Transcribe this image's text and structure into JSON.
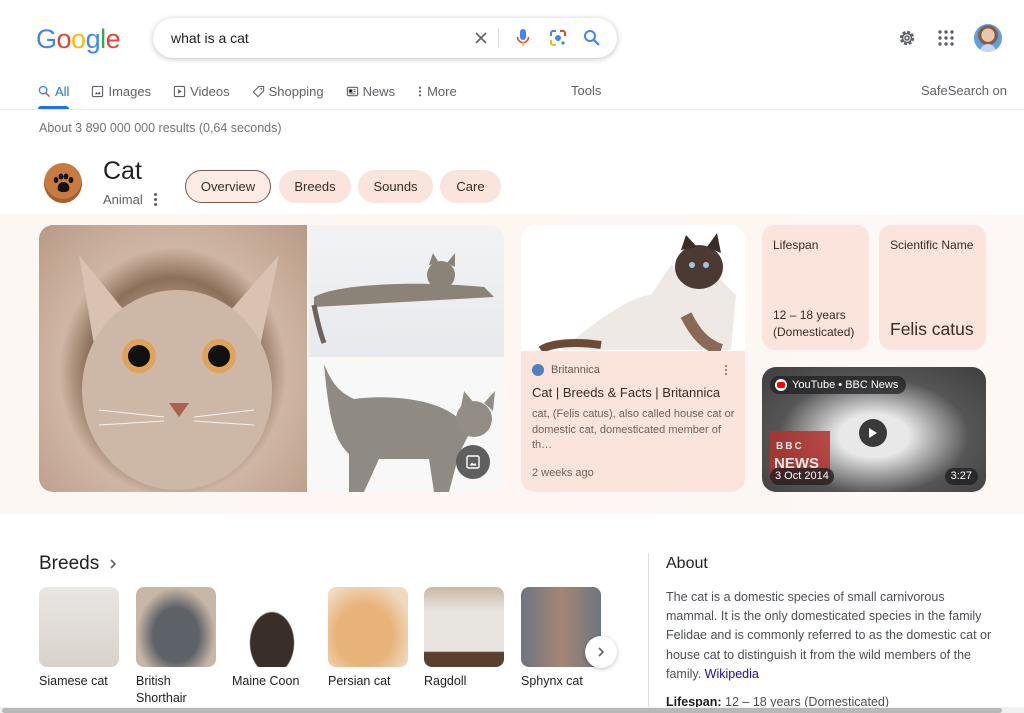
{
  "header": {
    "logo_letters": [
      {
        "ch": "G",
        "color": "#4285f4"
      },
      {
        "ch": "o",
        "color": "#ea4335"
      },
      {
        "ch": "o",
        "color": "#fbbc05"
      },
      {
        "ch": "g",
        "color": "#4285f4"
      },
      {
        "ch": "l",
        "color": "#34a853"
      },
      {
        "ch": "e",
        "color": "#ea4335"
      }
    ],
    "search_query": "what is a cat",
    "icons": [
      "clear-icon",
      "microphone-icon",
      "lens-icon",
      "search-icon",
      "gear-icon",
      "apps-grid-icon",
      "avatar"
    ]
  },
  "tabs": [
    {
      "label": "All",
      "icon": "search-icon",
      "active": true
    },
    {
      "label": "Images",
      "icon": "image-icon"
    },
    {
      "label": "Videos",
      "icon": "play-icon"
    },
    {
      "label": "Shopping",
      "icon": "tag-icon"
    },
    {
      "label": "News",
      "icon": "news-icon"
    },
    {
      "label": "More",
      "icon": "more-vertical-icon"
    }
  ],
  "tools_label": "Tools",
  "safesearch_label": "SafeSearch on",
  "stats": "About 3 890 000 000 results (0,64 seconds)",
  "entity": {
    "title": "Cat",
    "subtitle": "Animal",
    "chips": [
      {
        "label": "Overview",
        "active": true
      },
      {
        "label": "Breeds"
      },
      {
        "label": "Sounds"
      },
      {
        "label": "Care"
      }
    ]
  },
  "britannica": {
    "source": "Britannica",
    "title": "Cat | Breeds & Facts | Britannica",
    "description": "cat, (Felis catus), also called house cat or domestic cat, domesticated member of th…",
    "date": "2 weeks ago"
  },
  "facts": [
    {
      "label": "Lifespan",
      "value": "12 – 18 years (Domesticated)"
    },
    {
      "label": "Scientific Name",
      "value": "Felis catus"
    }
  ],
  "video": {
    "source": "YouTube • BBC News",
    "date": "3 Oct 2014",
    "duration": "3:27",
    "overlay_brand": "BBC",
    "overlay_word": "NEWS"
  },
  "breeds": {
    "title": "Breeds",
    "items": [
      {
        "name": "Siamese cat",
        "color": "#e6e2de"
      },
      {
        "name": "British Shorthair",
        "color": "#6b6f75"
      },
      {
        "name": "Maine Coon",
        "color": "#3a2e28"
      },
      {
        "name": "Persian cat",
        "color": "#e1a868"
      },
      {
        "name": "Ragdoll",
        "color": "#d7d2ce"
      },
      {
        "name": "Sphynx cat",
        "color": "#a58a7a"
      }
    ]
  },
  "about": {
    "title": "About",
    "text": "The cat is a domestic species of small carnivorous mammal. It is the only domesticated species in the family Felidae and is commonly referred to as the domestic cat or house cat to distinguish it from the wild members of the family.",
    "link": "Wikipedia",
    "fact_label": "Lifespan:",
    "fact_value": "12 – 18 years (Domesticated)"
  }
}
